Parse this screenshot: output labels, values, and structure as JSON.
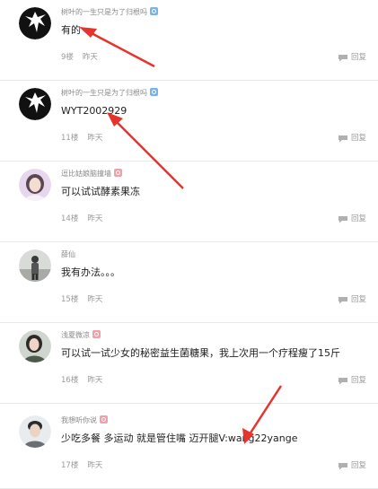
{
  "reply_label": "回复",
  "colors": {
    "arrow": "#e8322c",
    "badge_blue": "#7ab3e6",
    "badge_pink": "#f0a0a8"
  },
  "comments": [
    {
      "username": "树叶的一生只是为了归根吗",
      "badge": "blue",
      "content": "有的",
      "floor": "9楼",
      "time": "昨天",
      "avatar": "black-silhouette-avatar"
    },
    {
      "username": "树叶的一生只是为了归根吗",
      "badge": "blue",
      "content": "WYT2002929",
      "floor": "11楼",
      "time": "昨天",
      "avatar": "black-silhouette-avatar"
    },
    {
      "username": "逗比姑娘脑撞墙",
      "badge": "pink",
      "content": "可以试试酵素果冻",
      "floor": "14楼",
      "time": "昨天",
      "avatar": "girl-photo-avatar"
    },
    {
      "username": "薛仙",
      "badge": "none",
      "content": "我有办法。。。",
      "floor": "15楼",
      "time": "昨天",
      "avatar": "street-photo-avatar"
    },
    {
      "username": "浅夏微凉",
      "badge": "pink",
      "content": "可以试一试少女的秘密益生菌糖果，我上次用一个疗程瘦了15斤",
      "floor": "16楼",
      "time": "昨天",
      "avatar": "woman-photo-avatar"
    },
    {
      "username": "我想听你说",
      "badge": "pink",
      "content": "少吃多餐  多运动  就是管住嘴  迈开腿V:wang22yange",
      "floor": "17楼",
      "time": "昨天",
      "avatar": "man-photo-avatar"
    }
  ]
}
